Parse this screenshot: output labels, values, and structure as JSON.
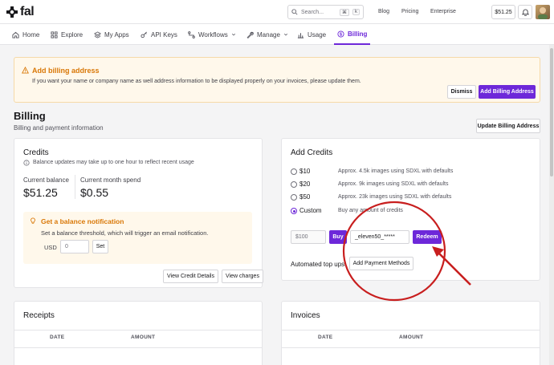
{
  "topbar": {
    "logo": "fal",
    "search_placeholder": "Search...",
    "search_kbd1": "⌘",
    "search_kbd2": "k",
    "links": [
      "Blog",
      "Pricing",
      "Enterprise"
    ],
    "balance": "$51.25"
  },
  "nav": {
    "tabs": [
      {
        "label": "Home",
        "icon": "home-icon"
      },
      {
        "label": "Explore",
        "icon": "grid-icon"
      },
      {
        "label": "My Apps",
        "icon": "layers-icon"
      },
      {
        "label": "API Keys",
        "icon": "key-icon"
      },
      {
        "label": "Workflows",
        "icon": "workflow-icon",
        "dropdown": true
      },
      {
        "label": "Manage",
        "icon": "wrench-icon",
        "dropdown": true
      },
      {
        "label": "Usage",
        "icon": "chart-icon"
      },
      {
        "label": "Billing",
        "icon": "dollar-icon",
        "active": true
      }
    ]
  },
  "alert": {
    "title": "Add billing address",
    "text": "If you want your name or company name as well address information to be displayed properly on your invoices, please update them.",
    "dismiss": "Dismiss",
    "add_address": "Add Billing Address"
  },
  "page": {
    "title": "Billing",
    "subtitle": "Billing and payment information",
    "update_address": "Update Billing Address"
  },
  "credits": {
    "title": "Credits",
    "note": "Balance updates may take up to one hour to reflect recent usage",
    "current_balance_label": "Current balance",
    "current_balance": "$51.25",
    "month_spend_label": "Current month spend",
    "month_spend": "$0.55",
    "notify_title": "Get a balance notification",
    "notify_text": "Set a balance threshold, which will trigger an email notification.",
    "currency": "USD",
    "threshold_value": "0",
    "set": "Set",
    "view_details": "View Credit Details",
    "view_charges": "View charges"
  },
  "add_credits": {
    "title": "Add Credits",
    "options": [
      {
        "label": "$10",
        "desc": "Approx. 4.5k images using SDXL with defaults",
        "checked": false
      },
      {
        "label": "$20",
        "desc": "Approx. 9k images using SDXL with defaults",
        "checked": false
      },
      {
        "label": "$50",
        "desc": "Approx. 23k images using SDXL with defaults",
        "checked": false
      },
      {
        "label": "Custom",
        "desc": "Buy any amount of credits",
        "checked": true
      }
    ],
    "amount_placeholder": "$100",
    "buy": "Buy",
    "coupon_value": "_eleven50_*****",
    "redeem": "Redeem",
    "auto_topup": "Automated top ups",
    "add_payment": "Add Payment Methods"
  },
  "receipts": {
    "title": "Receipts",
    "columns": [
      "DATE",
      "AMOUNT"
    ]
  },
  "invoices": {
    "title": "Invoices",
    "columns": [
      "DATE",
      "AMOUNT"
    ]
  },
  "colors": {
    "accent": "#6d28d9",
    "warning": "#d97706",
    "annotation": "#c81e1e"
  }
}
